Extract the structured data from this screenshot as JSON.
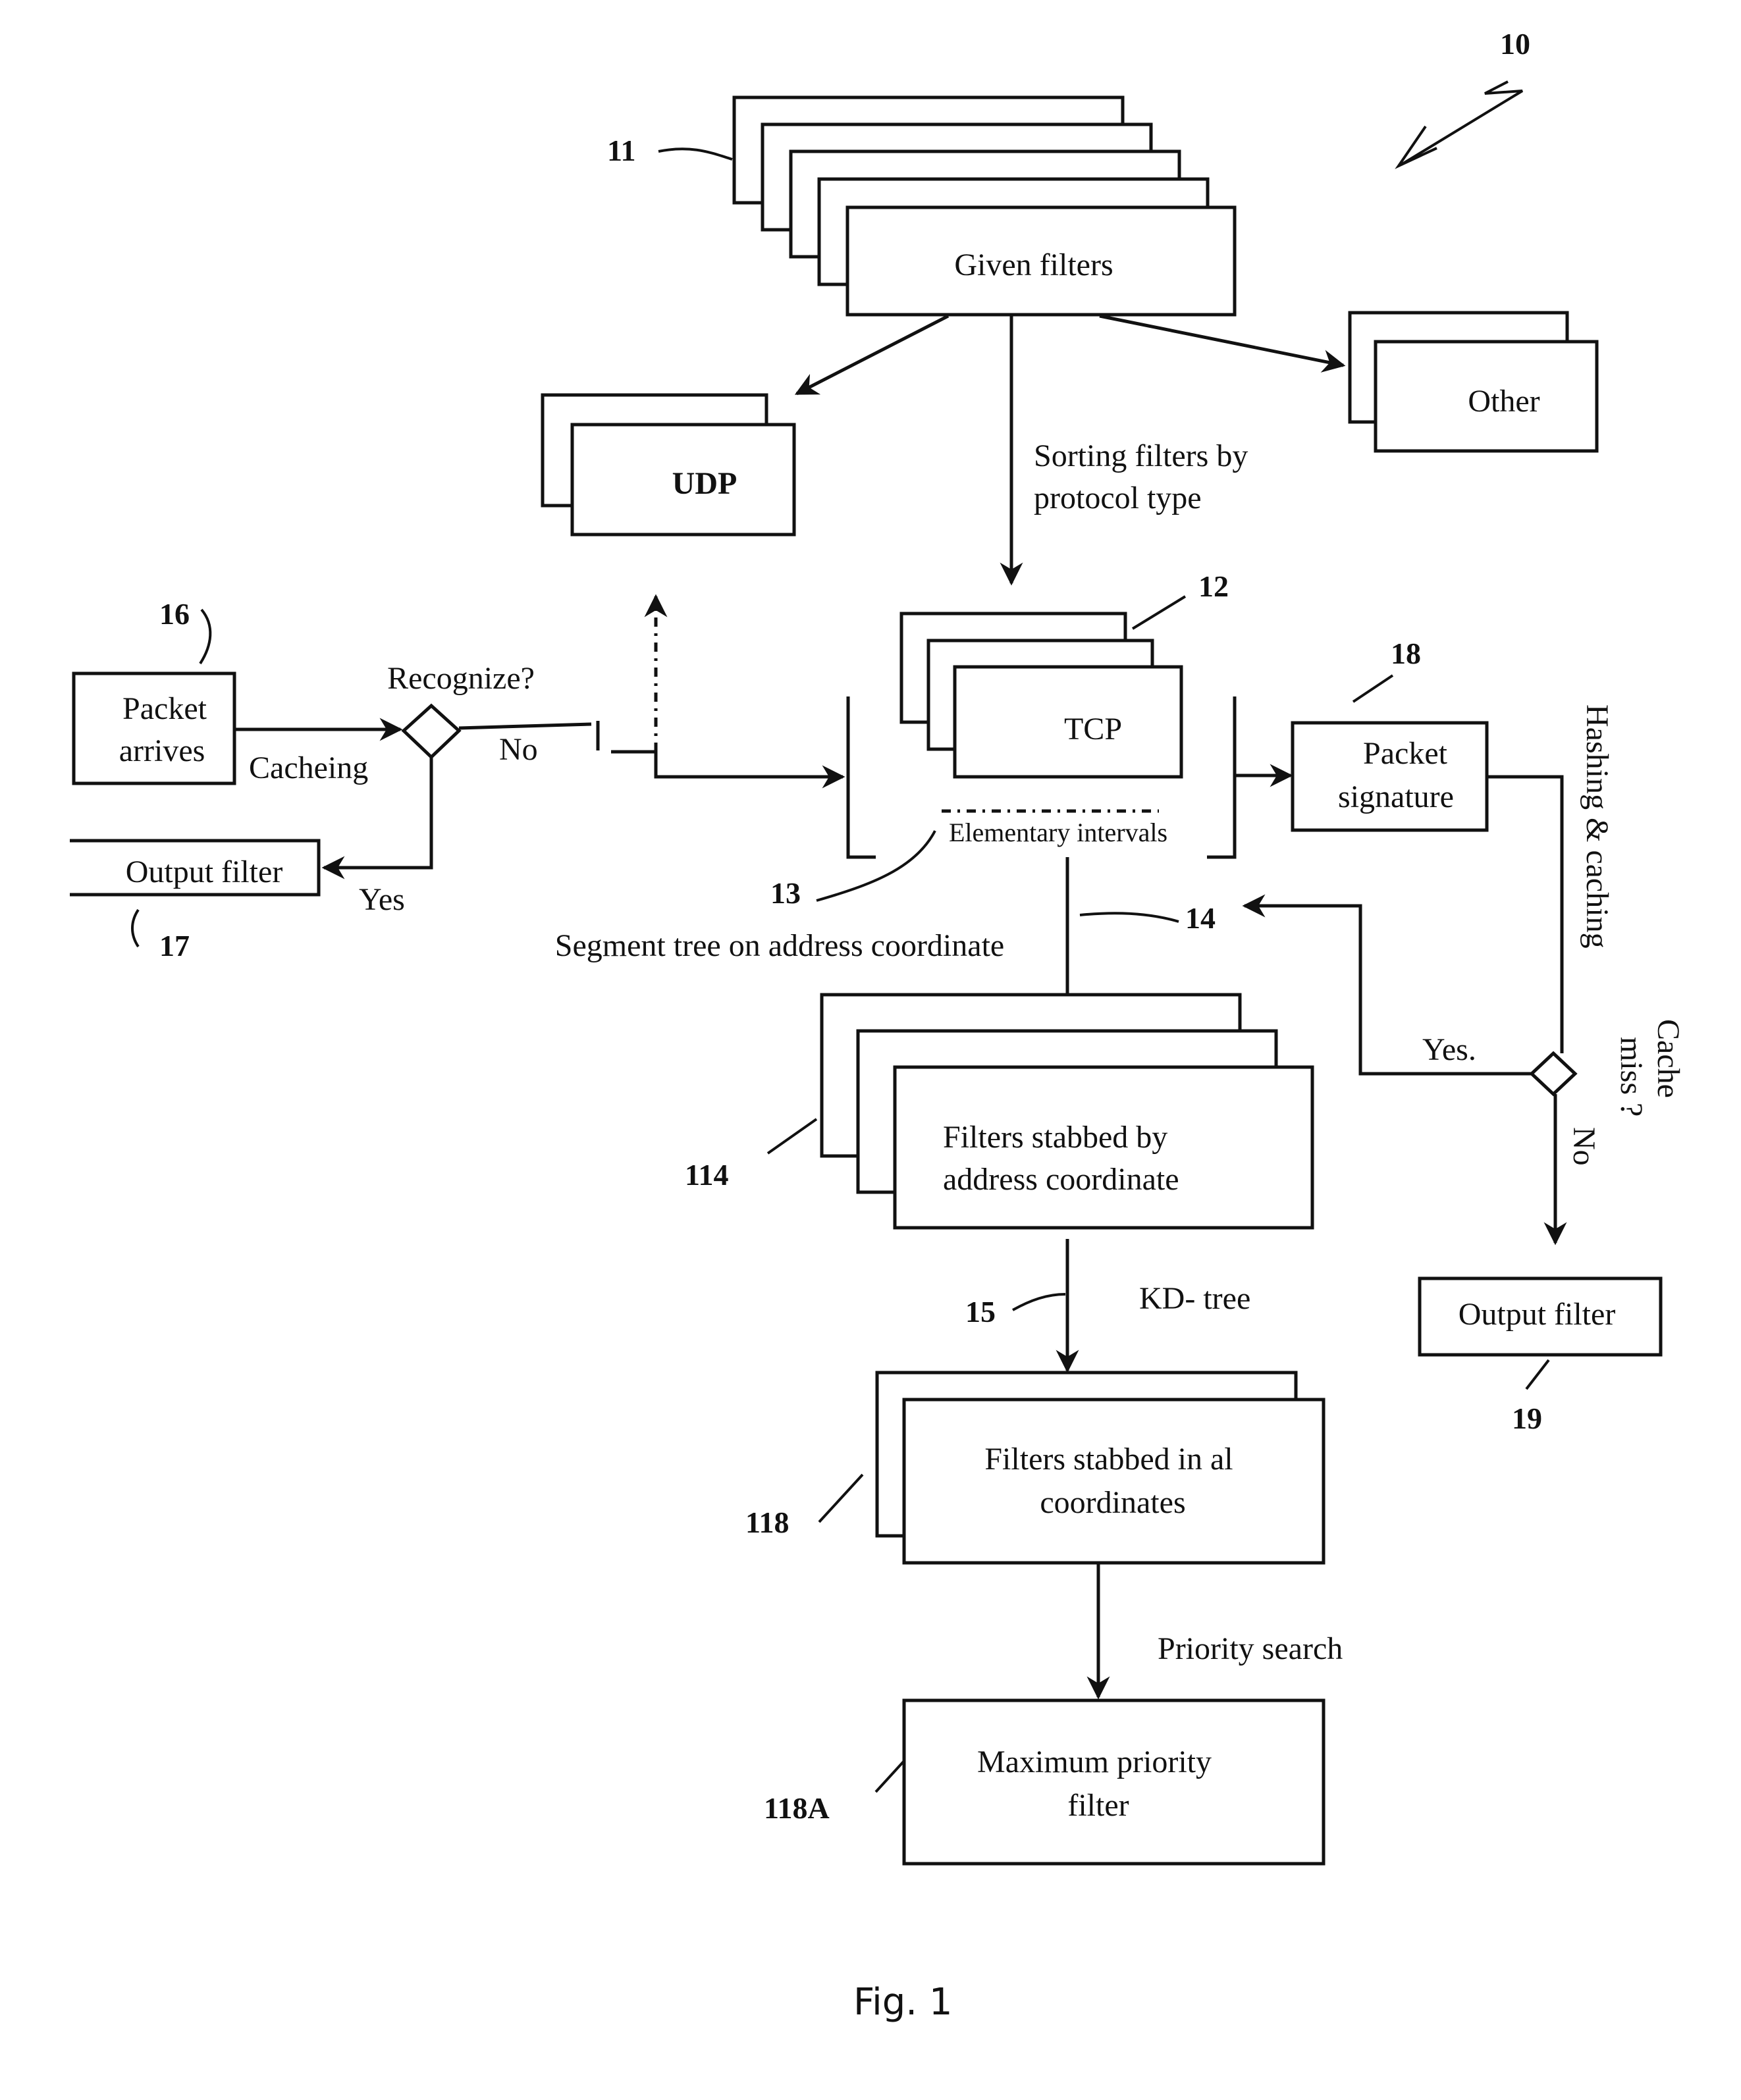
{
  "figure": {
    "caption": "Fig. 1",
    "reference_numeral": "10"
  },
  "nodes": {
    "given_filters": {
      "label": "Given filters",
      "ref": "11"
    },
    "udp": {
      "label": "UDP"
    },
    "other": {
      "label": "Other"
    },
    "tcp": {
      "label": "TCP",
      "ref": "12"
    },
    "elementary_intervals": {
      "label": "Elementary intervals",
      "ref": "13"
    },
    "packet_arrives": {
      "line1": "Packet",
      "line2": "arrives",
      "ref": "16"
    },
    "recognize_decision": {
      "label": "Recognize?"
    },
    "output_filter_left": {
      "label": "Output filter",
      "ref": "17"
    },
    "packet_signature": {
      "line1": "Packet",
      "line2": "signature",
      "ref": "18"
    },
    "cache_miss_decision": {
      "line1": "Cache",
      "line2": "miss ?"
    },
    "output_filter_right": {
      "label": "Output filter",
      "ref": "19"
    },
    "filters_by_address": {
      "line1": "Filters stabbed by",
      "line2": "address coordinate",
      "ref": "114"
    },
    "filters_all_coords": {
      "line1": "Filters stabbed in al",
      "line2": "coordinates",
      "ref": "118"
    },
    "max_priority_filter": {
      "line1": "Maximum priority",
      "line2": "filter",
      "ref": "118A"
    }
  },
  "edges": {
    "sorting_line1": "Sorting filters by",
    "sorting_line2": "protocol type",
    "caching": "Cacheing",
    "no_left": "No",
    "yes_left": "Yes",
    "segment_tree": "Segment tree on  address coordinate",
    "segment_tree_ref": "14",
    "hashing_caching": "Hashing & caching",
    "yes_right": "Yes.",
    "no_right": "No",
    "kd_tree": "KD- tree",
    "kd_tree_ref": "15",
    "priority_search": "Priority search"
  }
}
